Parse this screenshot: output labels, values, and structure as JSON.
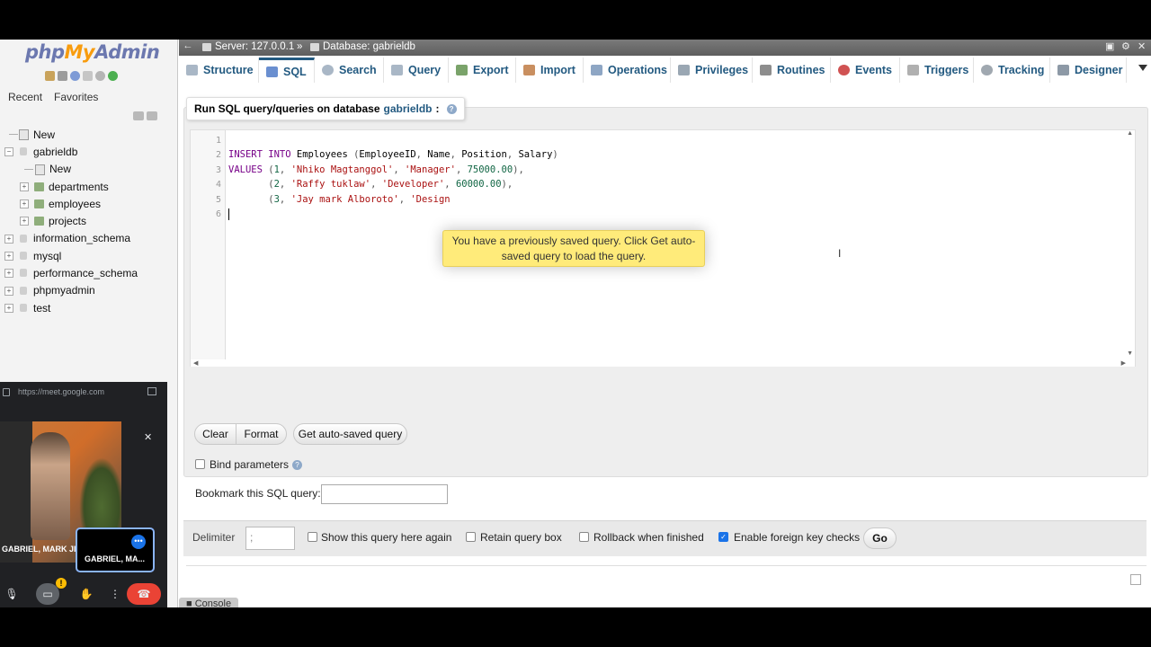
{
  "logo": {
    "php": "php",
    "my": "My",
    "admin": "Admin"
  },
  "left_tabs": [
    "Recent",
    "Favorites"
  ],
  "tree": [
    {
      "label": "New",
      "kind": "new",
      "indent": 0
    },
    {
      "label": "gabrieldb",
      "kind": "db",
      "indent": 0,
      "expanded": true
    },
    {
      "label": "New",
      "kind": "new",
      "indent": 1
    },
    {
      "label": "departments",
      "kind": "table",
      "indent": 1
    },
    {
      "label": "employees",
      "kind": "table",
      "indent": 1
    },
    {
      "label": "projects",
      "kind": "table",
      "indent": 1
    },
    {
      "label": "information_schema",
      "kind": "db",
      "indent": 0
    },
    {
      "label": "mysql",
      "kind": "db",
      "indent": 0
    },
    {
      "label": "performance_schema",
      "kind": "db",
      "indent": 0
    },
    {
      "label": "phpmyadmin",
      "kind": "db",
      "indent": 0
    },
    {
      "label": "test",
      "kind": "db",
      "indent": 0
    }
  ],
  "meet": {
    "url": "https://meet.google.com",
    "participant_a": "GABRIEL, MARK JI",
    "participant_b": "GABRIEL, MA...",
    "warning_badge": "!"
  },
  "topbar": {
    "server_label": "Server: 127.0.0.1",
    "separator": "»",
    "database_label": "Database: gabrieldb"
  },
  "tabs": [
    "Structure",
    "SQL",
    "Search",
    "Query",
    "Export",
    "Import",
    "Operations",
    "Privileges",
    "Routines",
    "Events",
    "Triggers",
    "Tracking",
    "Designer"
  ],
  "active_tab": "SQL",
  "sql_panel": {
    "title_prefix": "Run SQL query/queries on database",
    "database": "gabrieldb",
    "title_suffix": ":",
    "line_numbers": [
      "1",
      "2",
      "3",
      "4",
      "5",
      "6"
    ],
    "tooltip": "You have a previously saved query. Click Get auto-saved query to load the query."
  },
  "buttons": {
    "clear": "Clear",
    "format": "Format",
    "autosave": "Get auto-saved query",
    "go": "Go"
  },
  "bind_parameters": "Bind parameters",
  "bookmark_label": "Bookmark this SQL query:",
  "delimiter": {
    "label": "Delimiter",
    "value": ";"
  },
  "options": {
    "show_query": "Show this query here again",
    "retain": "Retain query box",
    "rollback": "Rollback when finished",
    "foreign_keys": "Enable foreign key checks"
  },
  "console": "Console"
}
